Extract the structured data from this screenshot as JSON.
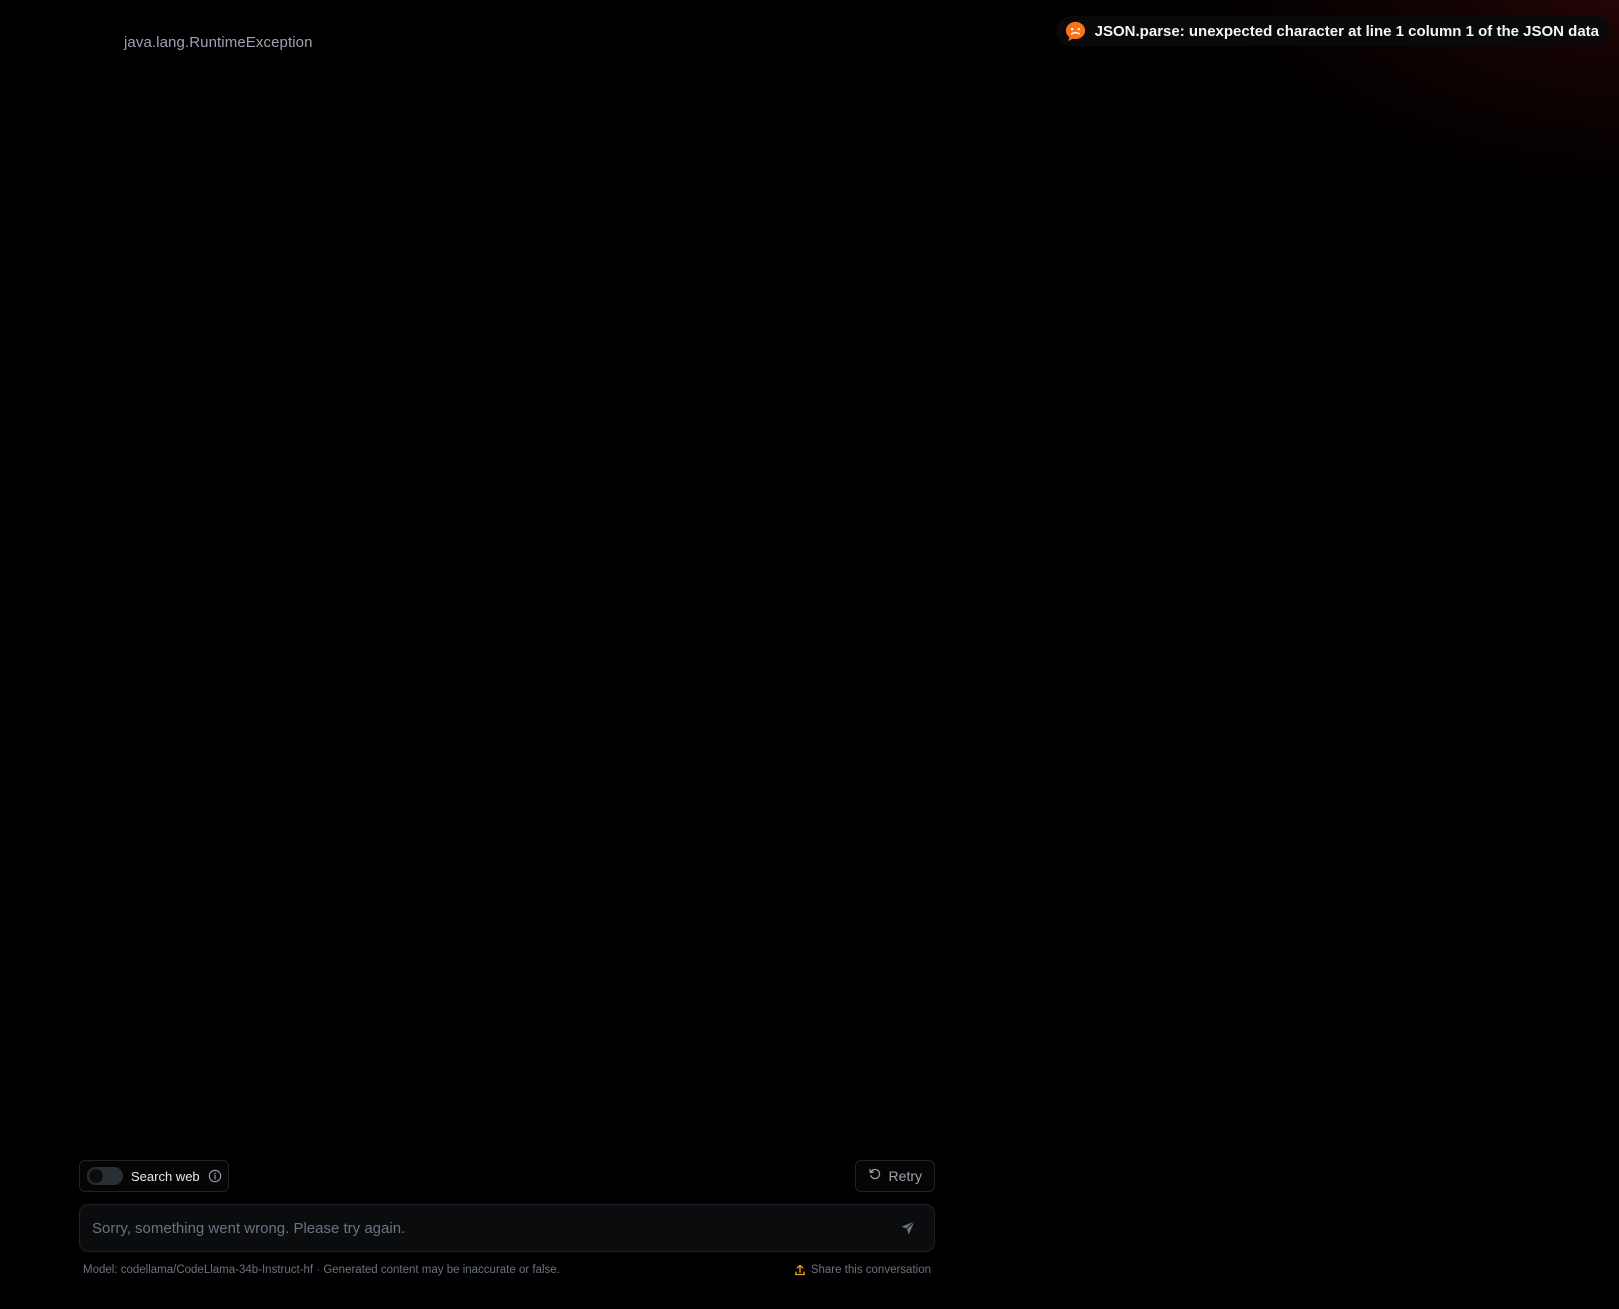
{
  "conversation": {
    "title": "java.lang.RuntimeException"
  },
  "toast": {
    "icon": "frown-face-icon",
    "message": "JSON.parse: unexpected character at line 1 column 1 of the JSON data",
    "accent_color": "#f97316"
  },
  "controls": {
    "search_web_label": "Search web",
    "search_web_enabled": false,
    "retry_label": "Retry"
  },
  "input": {
    "placeholder": "Sorry, something went wrong. Please try again.",
    "value": ""
  },
  "footer": {
    "model_text": "Model: codellama/CodeLlama-34b-Instruct-hf · Generated content may be inaccurate or false.",
    "share_label": "Share this conversation"
  },
  "colors": {
    "background": "#000000",
    "share_icon": "#f59e0b"
  }
}
